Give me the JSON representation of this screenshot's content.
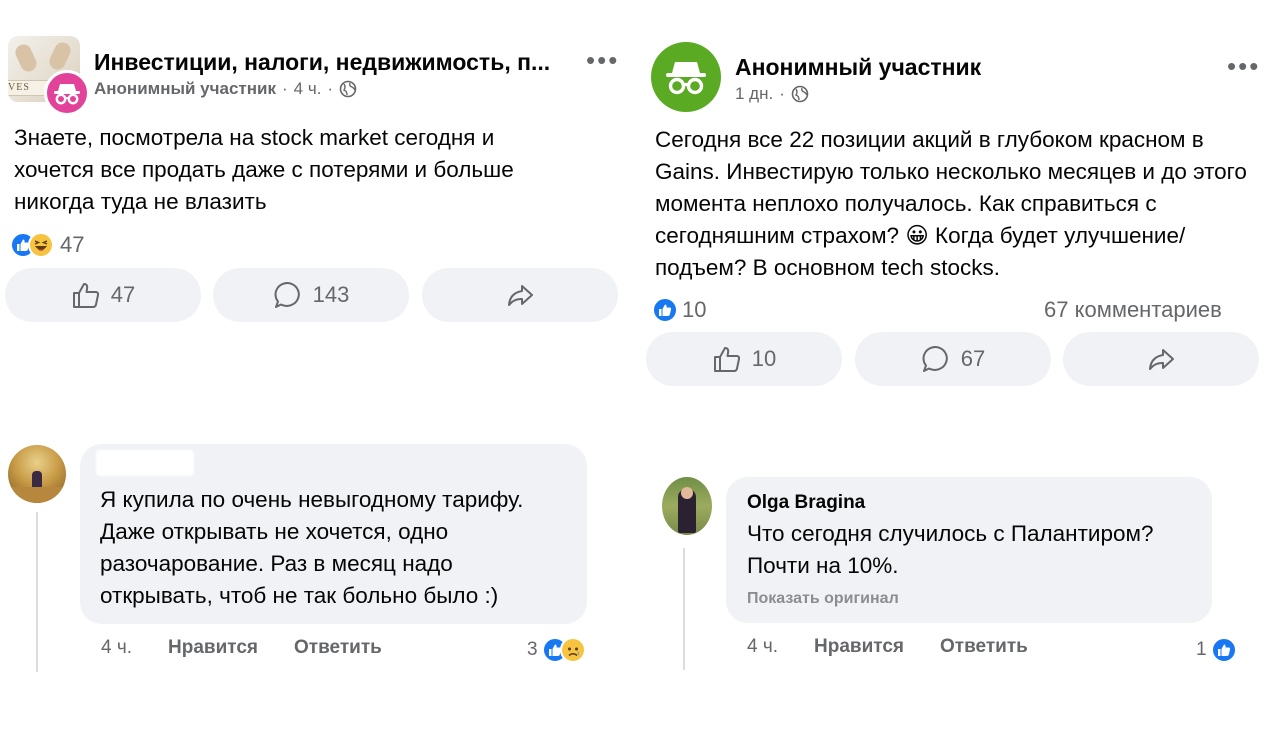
{
  "post_left": {
    "group_name": "Инвестиции, налоги, недвижимость, п...",
    "group_avatar_text": "VES",
    "author": "Анонимный участник",
    "time": "4 ч.",
    "separator": "·",
    "more": "•••",
    "body": "Знаете, посмотрела на stock market сегодня и хочется все продать даже с потерями и больше никогда туда не влазить",
    "reaction_count": "47",
    "like_count": "47",
    "comment_count": "143",
    "comment": {
      "text": "Я купила по очень невыгодному тарифу. Даже открывать не хочется, одно разочарование. Раз в месяц надо открывать, чтоб не так больно было :)",
      "time": "4 ч.",
      "like_label": "Нравится",
      "reply_label": "Ответить",
      "reaction_count": "3"
    }
  },
  "post_right": {
    "author": "Анонимный участник",
    "time": "1 дн.",
    "separator": "·",
    "more": "•••",
    "body": "Сегодня все 22 позиции акций в глубоком красном в Gains. Инвестирую только несколько месяцев и до этого момента неплохо получалось. Как справиться с сегодняшним страхом? 😀 Когда будет улучшение/подъем? В основном tech stocks.",
    "reaction_count": "10",
    "comments_summary": "67 комментариев",
    "like_count": "10",
    "comment_count": "67",
    "comment": {
      "author": "Olga Bragina",
      "text": "Что сегодня случилось с Палантиром? Почти на 10%.",
      "show_original": "Показать оригинал",
      "time": "4 ч.",
      "like_label": "Нравится",
      "reply_label": "Ответить",
      "reaction_count": "1"
    }
  },
  "colors": {
    "like_blue": "#1877f2",
    "gray_text": "#65676b",
    "bubble_bg": "#f0f2f5",
    "anon_pink": "#e3429a",
    "anon_green": "#5aaa23"
  }
}
